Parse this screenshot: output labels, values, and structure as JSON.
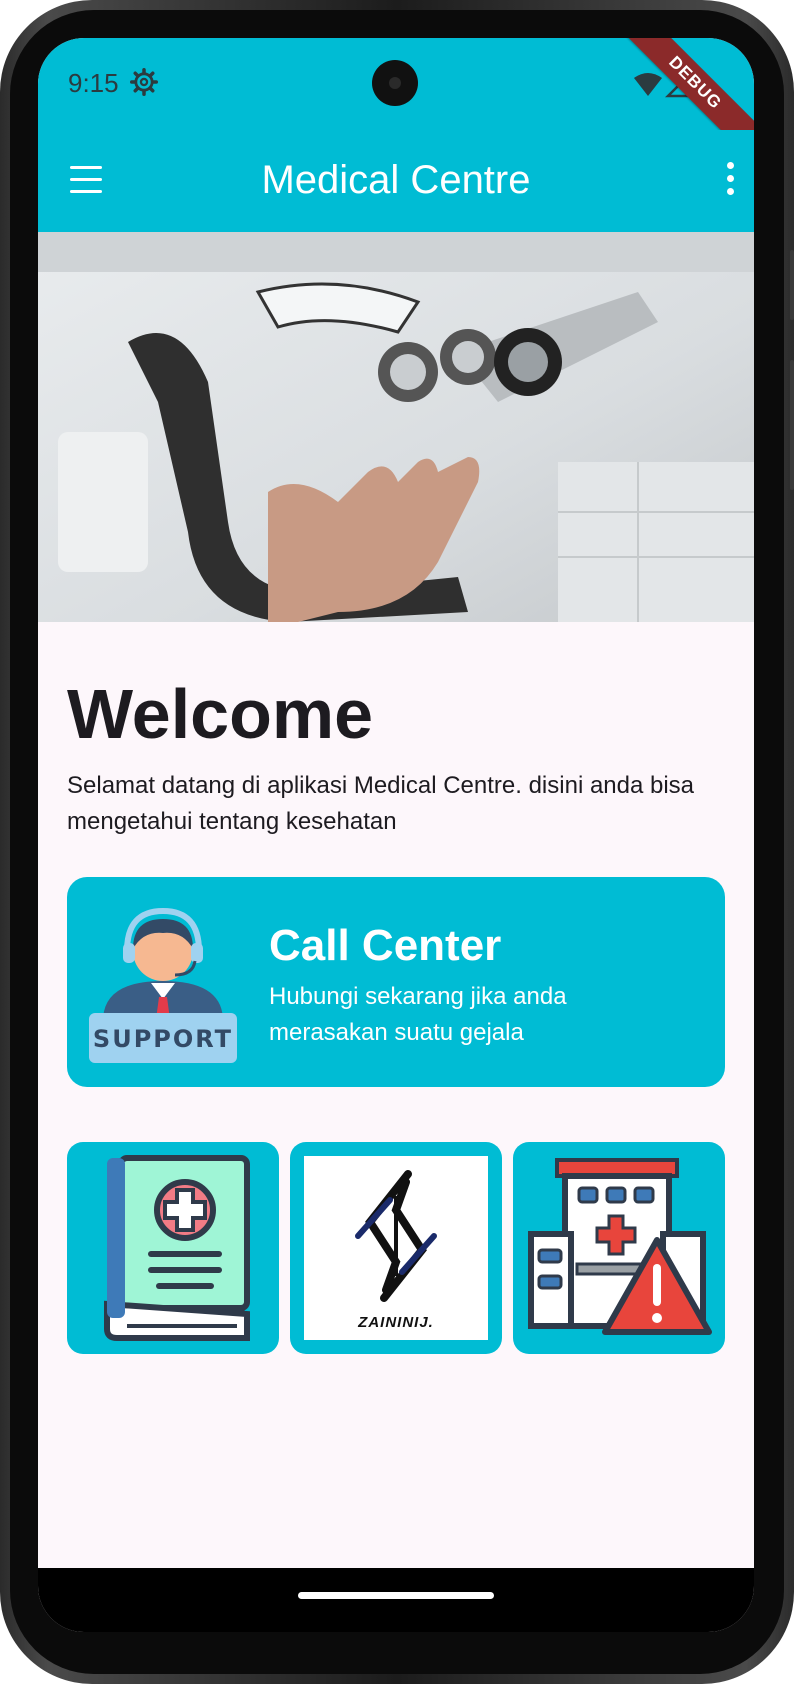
{
  "status_bar": {
    "time": "9:15",
    "debug_label": "DEBUG"
  },
  "app_bar": {
    "title": "Medical Centre",
    "background_color": "#00bcd4"
  },
  "hero": {
    "description": "Dental clinic photo with hand holding surgical loupes"
  },
  "welcome": {
    "title": "Welcome",
    "description": "Selamat datang di aplikasi Medical Centre. disini anda bisa mengetahui tentang kesehatan"
  },
  "call_center": {
    "title": "Call Center",
    "description": "Hubungi sekarang jika anda\n merasakan suatu gejala",
    "icon_label": "SUPPORT"
  },
  "tiles": [
    {
      "icon": "medical-book-icon"
    },
    {
      "icon": "logo",
      "logo_text": "ZAININIJ."
    },
    {
      "icon": "hospital-alert-icon"
    }
  ],
  "colors": {
    "accent": "#00bcd4",
    "background": "#fdf7fb",
    "text": "#1d1b20"
  }
}
